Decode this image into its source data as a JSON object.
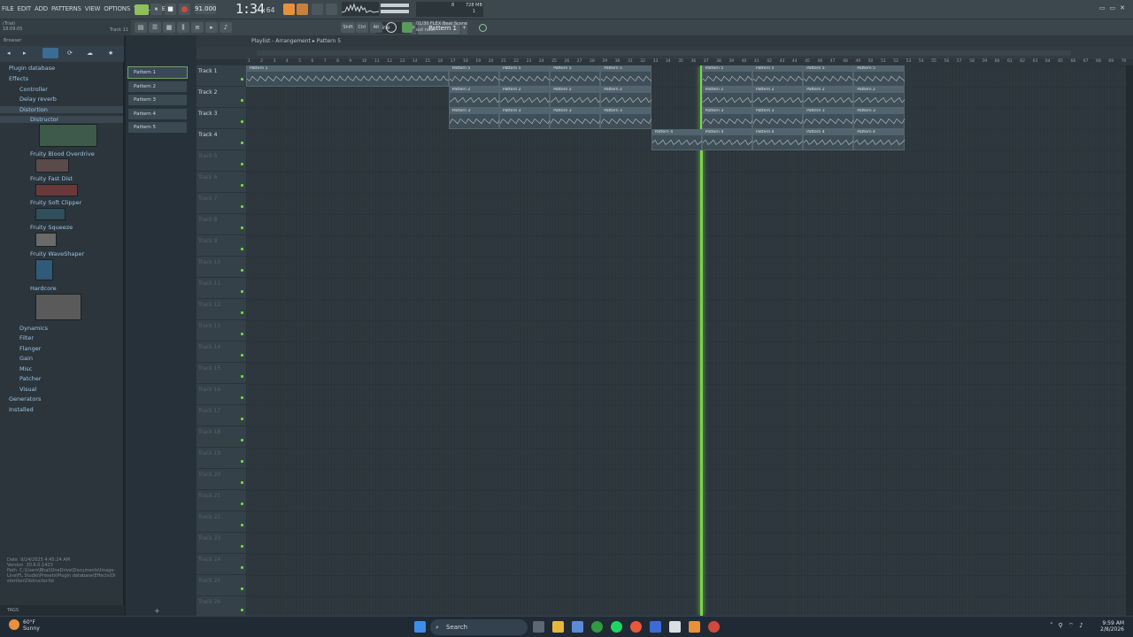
{
  "menu": {
    "items": [
      "FILE",
      "EDIT",
      "ADD",
      "PATTERNS",
      "VIEW",
      "OPTIONS",
      "TOOLS",
      "HELP"
    ]
  },
  "hint": {
    "line1": "(Trial)",
    "line2": "18:09:05",
    "track": "Track 11"
  },
  "transport": {
    "tempo": "91.000",
    "time": "1:34",
    "time_sub": ":64",
    "pattern": "Pattern 1",
    "snap": "Line",
    "news_title": "01/30 FLEX Beat Scene",
    "news_sub": "out now!",
    "mem": "728 MB",
    "cpu_num": "8",
    "poly": "1"
  },
  "toolbar": {
    "shift": "Shift",
    "ctrl": "Ctrl",
    "alt": "Alt"
  },
  "browser": {
    "title": "Browser",
    "root": "Plugin database",
    "items": [
      {
        "label": "Effects",
        "indent": 10
      },
      {
        "label": "Controller",
        "indent": 22
      },
      {
        "label": "Delay reverb",
        "indent": 22
      },
      {
        "label": "Distortion",
        "indent": 22
      },
      {
        "label": "Distructor",
        "indent": 34
      },
      {
        "label": "Fruity Blood Overdrive",
        "indent": 34
      },
      {
        "label": "Fruity Fast Dist",
        "indent": 34
      },
      {
        "label": "Fruity Soft Clipper",
        "indent": 34
      },
      {
        "label": "Fruity Squeeze",
        "indent": 34
      },
      {
        "label": "Fruity WaveShaper",
        "indent": 34
      },
      {
        "label": "Hardcore",
        "indent": 34
      },
      {
        "label": "Dynamics",
        "indent": 22
      },
      {
        "label": "Filter",
        "indent": 22
      },
      {
        "label": "Flanger",
        "indent": 22
      },
      {
        "label": "Gain",
        "indent": 22
      },
      {
        "label": "Misc",
        "indent": 22
      },
      {
        "label": "Patcher",
        "indent": 22
      },
      {
        "label": "Visual",
        "indent": 22
      },
      {
        "label": "Generators",
        "indent": 10
      },
      {
        "label": "Installed",
        "indent": 10
      }
    ],
    "info_date_label": "Date",
    "info_date": "9/24/2025 4:45:24 AM",
    "info_version_label": "Version",
    "info_version": "20.6.0.1423",
    "info_path_label": "Path",
    "info_path": "C:\\Users\\Bhal\\OneDrive\\Documents\\Image-Line\\FL Studio\\Presets\\Plugin database\\Effects\\Distortion\\Distructor.fst",
    "tags": "TAGS"
  },
  "patterns": [
    "Pattern 1",
    "Pattern 2",
    "Pattern 3",
    "Pattern 4",
    "Pattern 5"
  ],
  "playlist": {
    "title": "Playlist - Arrangement",
    "crumb": "Pattern 5",
    "tracks": [
      "Track 1",
      "Track 2",
      "Track 3",
      "Track 4",
      "Track 5",
      "Track 6",
      "Track 7",
      "Track 8",
      "Track 9",
      "Track 10",
      "Track 11",
      "Track 12",
      "Track 13",
      "Track 14",
      "Track 15",
      "Track 16",
      "Track 17",
      "Track 18",
      "Track 19",
      "Track 20",
      "Track 21",
      "Track 22",
      "Track 23",
      "Track 24",
      "Track 25",
      "Track 26"
    ],
    "ruler": [
      "1",
      "2",
      "3",
      "4",
      "5",
      "6",
      "7",
      "8",
      "9",
      "10",
      "11",
      "12",
      "13",
      "14",
      "15",
      "16",
      "17",
      "18",
      "19",
      "20",
      "21",
      "22",
      "23",
      "24",
      "25",
      "26",
      "27",
      "28",
      "29",
      "30",
      "31",
      "32",
      "33",
      "34",
      "35",
      "36",
      "37",
      "38",
      "39",
      "40",
      "41",
      "42",
      "43",
      "44",
      "45",
      "46",
      "47",
      "48",
      "49",
      "50",
      "51",
      "52",
      "53",
      "54",
      "55",
      "56",
      "57",
      "58",
      "59",
      "60",
      "61",
      "62",
      "63",
      "64",
      "65",
      "66",
      "67",
      "68",
      "69",
      "70"
    ],
    "clips": [
      {
        "track": 0,
        "start": 1,
        "len": 16,
        "label": "Pattern 1"
      },
      {
        "track": 0,
        "start": 17,
        "len": 4,
        "label": "Pattern 5"
      },
      {
        "track": 0,
        "start": 21,
        "len": 4,
        "label": "Pattern 5"
      },
      {
        "track": 0,
        "start": 25,
        "len": 4,
        "label": "Pattern 5"
      },
      {
        "track": 0,
        "start": 29,
        "len": 4,
        "label": "Pattern 5"
      },
      {
        "track": 0,
        "start": 37,
        "len": 4,
        "label": "Pattern 5"
      },
      {
        "track": 0,
        "start": 41,
        "len": 4,
        "label": "Pattern 5"
      },
      {
        "track": 0,
        "start": 45,
        "len": 4,
        "label": "Pattern 5"
      },
      {
        "track": 0,
        "start": 49,
        "len": 4,
        "label": "Pattern 5"
      },
      {
        "track": 1,
        "start": 17,
        "len": 4,
        "label": "Pattern 2"
      },
      {
        "track": 1,
        "start": 21,
        "len": 4,
        "label": "Pattern 2"
      },
      {
        "track": 1,
        "start": 25,
        "len": 4,
        "label": "Pattern 2"
      },
      {
        "track": 1,
        "start": 29,
        "len": 4,
        "label": "Pattern 2"
      },
      {
        "track": 1,
        "start": 37,
        "len": 4,
        "label": "Pattern 2"
      },
      {
        "track": 1,
        "start": 41,
        "len": 4,
        "label": "Pattern 2"
      },
      {
        "track": 1,
        "start": 45,
        "len": 4,
        "label": "Pattern 2"
      },
      {
        "track": 1,
        "start": 49,
        "len": 4,
        "label": "Pattern 2"
      },
      {
        "track": 2,
        "start": 17,
        "len": 4,
        "label": "Pattern 3"
      },
      {
        "track": 2,
        "start": 21,
        "len": 4,
        "label": "Pattern 3"
      },
      {
        "track": 2,
        "start": 25,
        "len": 4,
        "label": "Pattern 3"
      },
      {
        "track": 2,
        "start": 29,
        "len": 4,
        "label": "Pattern 3"
      },
      {
        "track": 2,
        "start": 37,
        "len": 4,
        "label": "Pattern 3"
      },
      {
        "track": 2,
        "start": 41,
        "len": 4,
        "label": "Pattern 3"
      },
      {
        "track": 2,
        "start": 45,
        "len": 4,
        "label": "Pattern 3"
      },
      {
        "track": 2,
        "start": 49,
        "len": 4,
        "label": "Pattern 3"
      },
      {
        "track": 3,
        "start": 33,
        "len": 4,
        "label": "Pattern 4"
      },
      {
        "track": 3,
        "start": 37,
        "len": 4,
        "label": "Pattern 4"
      },
      {
        "track": 3,
        "start": 41,
        "len": 4,
        "label": "Pattern 4"
      },
      {
        "track": 3,
        "start": 45,
        "len": 4,
        "label": "Pattern 4"
      },
      {
        "track": 3,
        "start": 49,
        "len": 4,
        "label": "Pattern 4"
      }
    ],
    "playhead_bar": 36.9
  },
  "taskbar": {
    "temp": "60°F",
    "weather": "Sunny",
    "search": "Search",
    "time": "9:59 AM",
    "date": "2/8/2026"
  },
  "colors": {
    "accent_green": "#78d64a",
    "record_red": "#d04a3a",
    "orange": "#e8913a"
  }
}
